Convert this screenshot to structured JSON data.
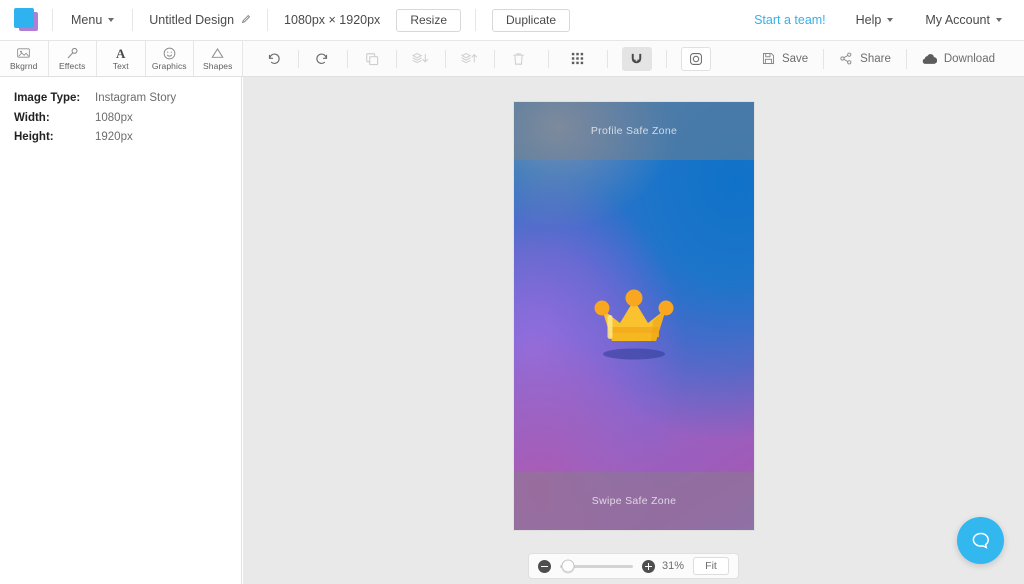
{
  "topbar": {
    "logo_name": "app-logo",
    "menu_label": "Menu",
    "design_title": "Untitled Design",
    "dimensions_label": "1080px × 1920px",
    "resize_label": "Resize",
    "duplicate_label": "Duplicate",
    "start_team_label": "Start a team!",
    "help_label": "Help",
    "account_label": "My Account",
    "link_color": "#38b0e8"
  },
  "tool_tabs": [
    {
      "label": "Bkgrnd",
      "icon": "image-icon"
    },
    {
      "label": "Effects",
      "icon": "magic-wand-icon"
    },
    {
      "label": "Text",
      "icon": "text-a-icon"
    },
    {
      "label": "Graphics",
      "icon": "smiley-icon"
    },
    {
      "label": "Shapes",
      "icon": "triangle-icon"
    }
  ],
  "edit_tools": [
    {
      "name": "undo",
      "icon": "undo-icon",
      "state": "enabled"
    },
    {
      "name": "redo",
      "icon": "redo-icon",
      "state": "enabled"
    },
    {
      "name": "duplicate-layer",
      "icon": "copy-icon",
      "state": "disabled"
    },
    {
      "name": "send-backward",
      "icon": "layer-down-icon",
      "state": "disabled"
    },
    {
      "name": "bring-forward",
      "icon": "layer-up-icon",
      "state": "disabled"
    },
    {
      "name": "delete",
      "icon": "trash-icon",
      "state": "disabled"
    },
    {
      "name": "grid",
      "icon": "grid-icon",
      "state": "enabled"
    },
    {
      "name": "snap-to-guides",
      "icon": "magnet-icon",
      "state": "active"
    },
    {
      "name": "safe-zones",
      "icon": "instagram-camera-icon",
      "state": "enabled"
    }
  ],
  "right_tools": [
    {
      "label": "Save",
      "icon": "floppy-disk-icon"
    },
    {
      "label": "Share",
      "icon": "share-nodes-icon"
    },
    {
      "label": "Download",
      "icon": "cloud-download-icon"
    }
  ],
  "left_panel": {
    "rows": [
      {
        "key": "Image Type:",
        "value": "Instagram Story"
      },
      {
        "key": "Width:",
        "value": "1080px"
      },
      {
        "key": "Height:",
        "value": "1920px"
      }
    ]
  },
  "canvas": {
    "top_safe_zone_label": "Profile Safe Zone",
    "bottom_safe_zone_label": "Swipe Safe Zone",
    "artwork": "crown-graphic",
    "gradient_colors": [
      "#1a6fc0",
      "#5566d8",
      "#8a63c9",
      "#a05bb8"
    ],
    "crown_color": "#f9c22e",
    "crown_accent_color": "#f59a0f"
  },
  "zoom_controls": {
    "zoom_out_label": "zoom-out",
    "zoom_in_label": "zoom-in",
    "zoom_percent": "31%",
    "fit_label": "Fit",
    "slider_position_percent": 11
  },
  "help": {
    "icon": "chat-bubble-icon",
    "color": "#32b7ef"
  }
}
